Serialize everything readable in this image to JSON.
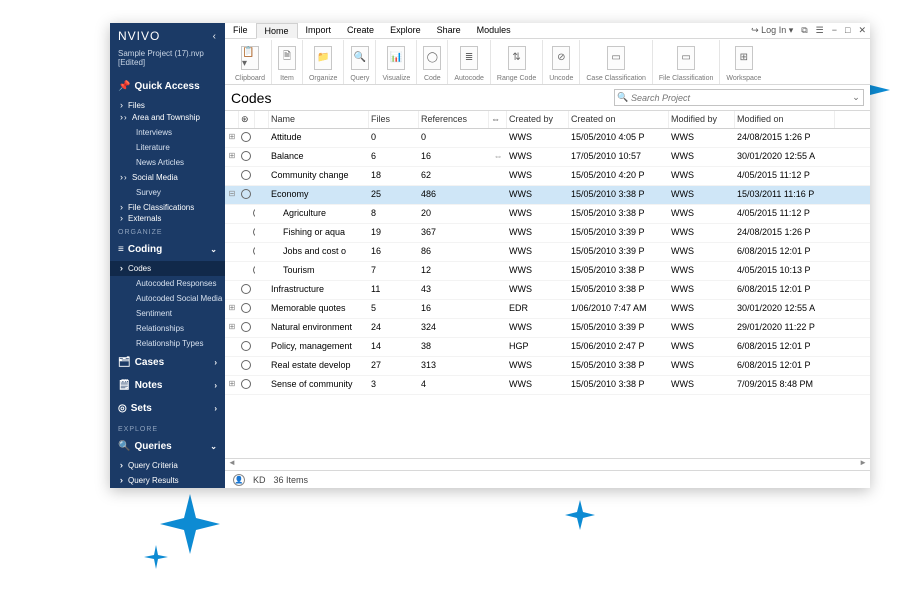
{
  "brand": "NVIVO",
  "project": "Sample Project (17).nvp [Edited]",
  "sidebar": {
    "quick_access": "Quick Access",
    "files_head": "Files",
    "files": [
      "Area and Township",
      "Interviews",
      "Literature",
      "News Articles",
      "Social Media",
      "Survey"
    ],
    "file_class": "File Classifications",
    "externals": "Externals",
    "organize": "ORGANIZE",
    "coding": "Coding",
    "coding_items": [
      "Codes",
      "Autocoded Responses",
      "Autocoded Social Media",
      "Sentiment",
      "Relationships",
      "Relationship Types"
    ],
    "cases": "Cases",
    "notes": "Notes",
    "sets": "Sets",
    "explore": "EXPLORE",
    "queries": "Queries",
    "queries_items": [
      "Query Criteria",
      "Query Results"
    ]
  },
  "menu": {
    "items": [
      "File",
      "Home",
      "Import",
      "Create",
      "Explore",
      "Share",
      "Modules"
    ],
    "active": 1,
    "right": {
      "login": "Log In",
      "icons": [
        "⧉",
        "☰",
        "−",
        "□",
        "✕"
      ]
    }
  },
  "ribbon": [
    {
      "label": "Clipboard",
      "icons": [
        "📋▾"
      ]
    },
    {
      "label": "Item",
      "icons": [
        "🗎"
      ]
    },
    {
      "label": "Organize",
      "icons": [
        "📁"
      ]
    },
    {
      "label": "Query",
      "icons": [
        "🔍"
      ]
    },
    {
      "label": "Visualize",
      "icons": [
        "📊"
      ]
    },
    {
      "label": "Code",
      "icons": [
        "◯"
      ]
    },
    {
      "label": "Autocode",
      "icons": [
        "≣"
      ]
    },
    {
      "label": "Range Code",
      "icons": [
        "⇅"
      ]
    },
    {
      "label": "Uncode",
      "icons": [
        "⊘"
      ]
    },
    {
      "label": "Case Classification",
      "icons": [
        "▭"
      ]
    },
    {
      "label": "File Classification",
      "icons": [
        "▭"
      ]
    },
    {
      "label": "Workspace",
      "icons": [
        "⊞"
      ]
    }
  ],
  "content": {
    "title": "Codes",
    "search_placeholder": "Search Project"
  },
  "columns": [
    "Name",
    "Files",
    "References",
    "",
    "Created by",
    "Created on",
    "Modified by",
    "Modified on"
  ],
  "rows": [
    {
      "exp": "⊞",
      "indent": 0,
      "name": "Attitude",
      "files": "0",
      "refs": "0",
      "link": "",
      "cby": "WWS",
      "con": "15/05/2010 4:05 P",
      "mby": "WWS",
      "mon": "24/08/2015 1:26 P"
    },
    {
      "exp": "⊞",
      "indent": 0,
      "name": "Balance",
      "files": "6",
      "refs": "16",
      "link": "⇔",
      "cby": "WWS",
      "con": "17/05/2010 10:57",
      "mby": "WWS",
      "mon": "30/01/2020 12:55 A"
    },
    {
      "exp": "",
      "indent": 0,
      "name": "Community change",
      "files": "18",
      "refs": "62",
      "link": "",
      "cby": "WWS",
      "con": "15/05/2010 4:20 P",
      "mby": "WWS",
      "mon": "4/05/2015 11:12 P"
    },
    {
      "exp": "⊟",
      "indent": 0,
      "name": "Economy",
      "files": "25",
      "refs": "486",
      "link": "",
      "cby": "WWS",
      "con": "15/05/2010 3:38 P",
      "mby": "WWS",
      "mon": "15/03/2011 11:16 P",
      "selected": true
    },
    {
      "exp": "",
      "indent": 1,
      "name": "Agriculture",
      "files": "8",
      "refs": "20",
      "link": "",
      "cby": "WWS",
      "con": "15/05/2010 3:38 P",
      "mby": "WWS",
      "mon": "4/05/2015 11:12 P"
    },
    {
      "exp": "",
      "indent": 1,
      "name": "Fishing or aqua",
      "files": "19",
      "refs": "367",
      "link": "",
      "cby": "WWS",
      "con": "15/05/2010 3:39 P",
      "mby": "WWS",
      "mon": "24/08/2015 1:26 P"
    },
    {
      "exp": "",
      "indent": 1,
      "name": "Jobs and cost o",
      "files": "16",
      "refs": "86",
      "link": "",
      "cby": "WWS",
      "con": "15/05/2010 3:39 P",
      "mby": "WWS",
      "mon": "6/08/2015 12:01 P"
    },
    {
      "exp": "",
      "indent": 1,
      "name": "Tourism",
      "files": "7",
      "refs": "12",
      "link": "",
      "cby": "WWS",
      "con": "15/05/2010 3:38 P",
      "mby": "WWS",
      "mon": "4/05/2015 10:13 P"
    },
    {
      "exp": "",
      "indent": 0,
      "name": "Infrastructure",
      "files": "11",
      "refs": "43",
      "link": "",
      "cby": "WWS",
      "con": "15/05/2010 3:38 P",
      "mby": "WWS",
      "mon": "6/08/2015 12:01 P"
    },
    {
      "exp": "⊞",
      "indent": 0,
      "name": "Memorable quotes",
      "files": "5",
      "refs": "16",
      "link": "",
      "cby": "EDR",
      "con": "1/06/2010 7:47 AM",
      "mby": "WWS",
      "mon": "30/01/2020 12:55 A"
    },
    {
      "exp": "⊞",
      "indent": 0,
      "name": "Natural environment",
      "files": "24",
      "refs": "324",
      "link": "",
      "cby": "WWS",
      "con": "15/05/2010 3:39 P",
      "mby": "WWS",
      "mon": "29/01/2020 11:22 P"
    },
    {
      "exp": "",
      "indent": 0,
      "name": "Policy, management",
      "files": "14",
      "refs": "38",
      "link": "",
      "cby": "HGP",
      "con": "15/06/2010 2:47 P",
      "mby": "WWS",
      "mon": "6/08/2015 12:01 P"
    },
    {
      "exp": "",
      "indent": 0,
      "name": "Real estate develop",
      "files": "27",
      "refs": "313",
      "link": "",
      "cby": "WWS",
      "con": "15/05/2010 3:38 P",
      "mby": "WWS",
      "mon": "6/08/2015 12:01 P"
    },
    {
      "exp": "⊞",
      "indent": 0,
      "name": "Sense of community",
      "files": "3",
      "refs": "4",
      "link": "",
      "cby": "WWS",
      "con": "15/05/2010 3:38 P",
      "mby": "WWS",
      "mon": "7/09/2015 8:48 PM"
    }
  ],
  "status": {
    "user": "KD",
    "items": "36 Items"
  }
}
